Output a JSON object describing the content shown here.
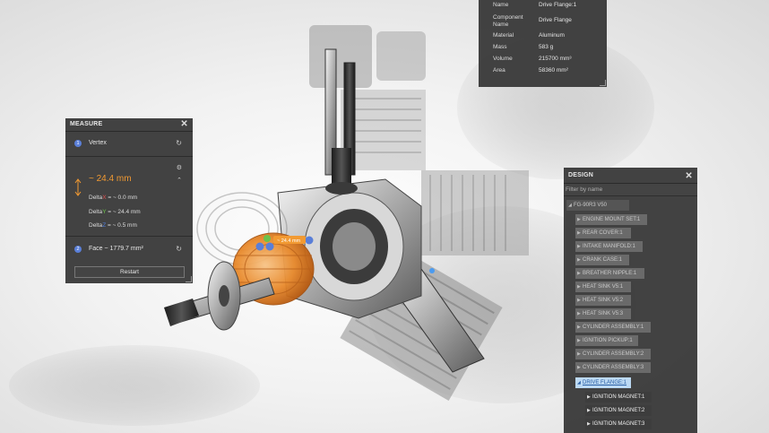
{
  "properties": {
    "rows": [
      {
        "label": "Name",
        "value": "Drive Flange:1"
      },
      {
        "label": "Component\nName",
        "value": "Drive Flange"
      },
      {
        "label": "Material",
        "value": "Aluminum"
      },
      {
        "label": "Mass",
        "value": "583 g"
      },
      {
        "label": "Volume",
        "value": "215700 mm³"
      },
      {
        "label": "Area",
        "value": "58360 mm²"
      }
    ]
  },
  "measure": {
    "title": "MEASURE",
    "point1": {
      "num": "1",
      "label": "Vertex"
    },
    "distance": "~ 24.4 mm",
    "deltas": [
      {
        "prefix": "Delta",
        "axis": "X",
        "value": " = ~ 0.0 mm",
        "color": "#e15252"
      },
      {
        "prefix": "Delta",
        "axis": "Y",
        "value": " = ~ 24.4 mm",
        "color": "#6cc24a"
      },
      {
        "prefix": "Delta",
        "axis": "Z",
        "value": " = ~ 0.5 mm",
        "color": "#4f7fe0"
      }
    ],
    "point2": {
      "num": "2",
      "label": "Face ~ 1779.7 mm²"
    },
    "restart_label": "Restart",
    "overlay_label": "~ 24.4 mm",
    "accent": "#f29a32"
  },
  "design": {
    "title": "DESIGN",
    "filter_placeholder": "Filter by name",
    "root": "FG-90R3 V50",
    "items": [
      "ENGINE MOUNT SET:1",
      "REAR COVER:1",
      "INTAKE MANIFOLD:1",
      "CRANK CASE:1",
      "BREATHER NIPPLE:1",
      "HEAT SINK V5:1",
      "HEAT SINK V5:2",
      "HEAT SINK V5:3",
      "CYLINDER ASSEMBLY:1",
      "IGNITION PICKUP:1",
      "CYLINDER ASSEMBLY:2",
      "CYLINDER ASSEMBLY:3"
    ],
    "selected": "DRIVE FLANGE:1",
    "children": [
      "IGNITION MAGNET:1",
      "IGNITION MAGNET:2",
      "IGNITION MAGNET:3"
    ]
  }
}
